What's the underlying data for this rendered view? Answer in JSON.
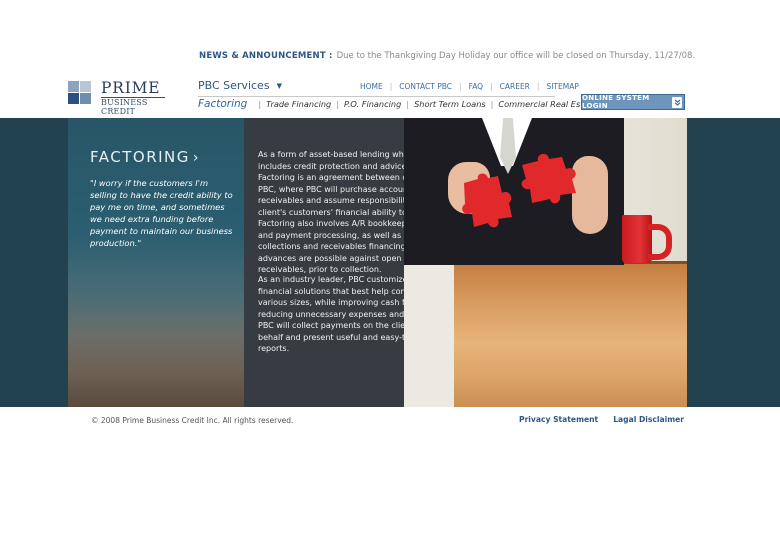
{
  "news": {
    "label": "NEWS & ANNOUNCEMENT :",
    "text": "Due to the Thankgiving Day Holiday our office will be closed on Thursday, 11/27/08."
  },
  "logo": {
    "name": "PRIME",
    "sub": "BUSINESS CREDIT"
  },
  "services": {
    "label": "PBC Services",
    "caret": "▼"
  },
  "topnav": [
    "HOME",
    "CONTACT PBC",
    "FAQ",
    "CAREER",
    "SITEMAP"
  ],
  "separator": "|",
  "subnav": {
    "active": "Factoring",
    "items": [
      "Trade Financing",
      "P.O. Financing",
      "Short Term Loans",
      "Commercial Real Estate Loan"
    ]
  },
  "login": {
    "label": "ONLINE SYSTEM LOGIN",
    "icon": "chevron-down-icon"
  },
  "hero": {
    "title": "FACTORING",
    "title_chevron": "›",
    "quote": "\"I worry if the customers I'm selling to have the credit ability to pay me on time, and sometimes we need extra funding before payment to maintain our business production.\"",
    "paragraph1": "As a form of asset-based lending which includes credit protection and advice, Factoring is an agreement between client and PBC, where PBC will purchase accounts receivables and assume responsibility for the client's customers' financial ability to pay. Factoring also involves A/R bookkeeping, EDI and payment processing, as well as collections and receivables financing. Cash advances are possible against open receivables, prior to collection.",
    "paragraph2": "As an industry leader, PBC customizes financial solutions that best help companies of various sizes, while improving cash flow and reducing unnecessary expenses and losses. PBC will collect payments on the client's behalf and present useful and easy-to-read reports."
  },
  "footer": {
    "copyright": "© 2008 Prime Business Credit Inc. All rights reserved.",
    "links": [
      "Privacy Statement",
      "Lagal Disclaimer"
    ]
  },
  "colors": {
    "brand_blue": "#2d5785",
    "link_blue": "#3b6ea5",
    "login_bg": "#6e95bb",
    "hero_band": "#23424f",
    "puzzle_red": "#e1292c"
  }
}
